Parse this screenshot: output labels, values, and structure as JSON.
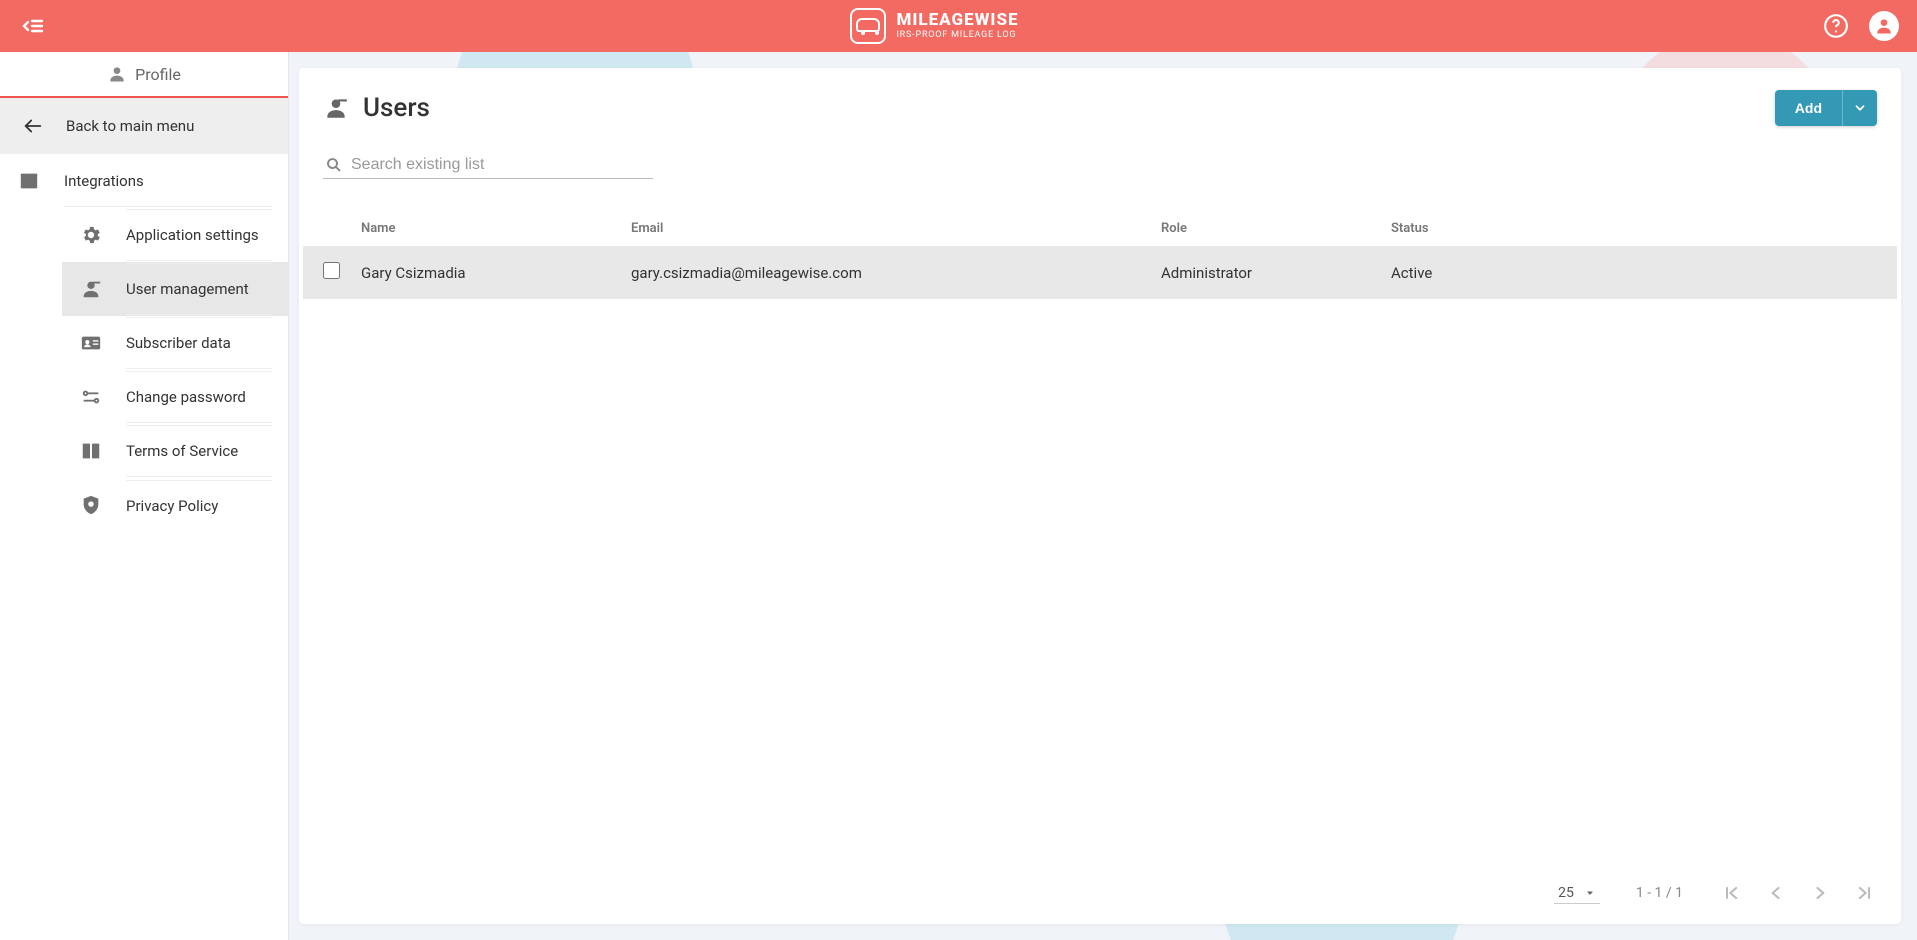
{
  "header": {
    "brand": "MILEAGEWISE",
    "tagline": "IRS-PROOF MILEAGE LOG"
  },
  "sidebar": {
    "profile_tab": "Profile",
    "back_label": "Back to main menu",
    "items": [
      {
        "label": "Integrations",
        "icon": "integrations-icon",
        "active": false
      },
      {
        "label": "Application settings",
        "icon": "gear-icon",
        "active": false
      },
      {
        "label": "User management",
        "icon": "user-manage-icon",
        "active": true
      },
      {
        "label": "Subscriber data",
        "icon": "id-card-icon",
        "active": false
      },
      {
        "label": "Change password",
        "icon": "key-icon",
        "active": false
      },
      {
        "label": "Terms of Service",
        "icon": "book-icon",
        "active": false
      },
      {
        "label": "Privacy Policy",
        "icon": "shield-icon",
        "active": false
      }
    ]
  },
  "main": {
    "title": "Users",
    "add_button": "Add",
    "search_placeholder": "Search existing list",
    "columns": {
      "name": "Name",
      "email": "Email",
      "role": "Role",
      "status": "Status"
    },
    "rows": [
      {
        "name": "Gary Csizmadia",
        "email": "gary.csizmadia@mileagewise.com",
        "role": "Administrator",
        "status": "Active"
      }
    ],
    "pagination": {
      "page_size": "25",
      "range": "1 - 1 / 1"
    }
  }
}
